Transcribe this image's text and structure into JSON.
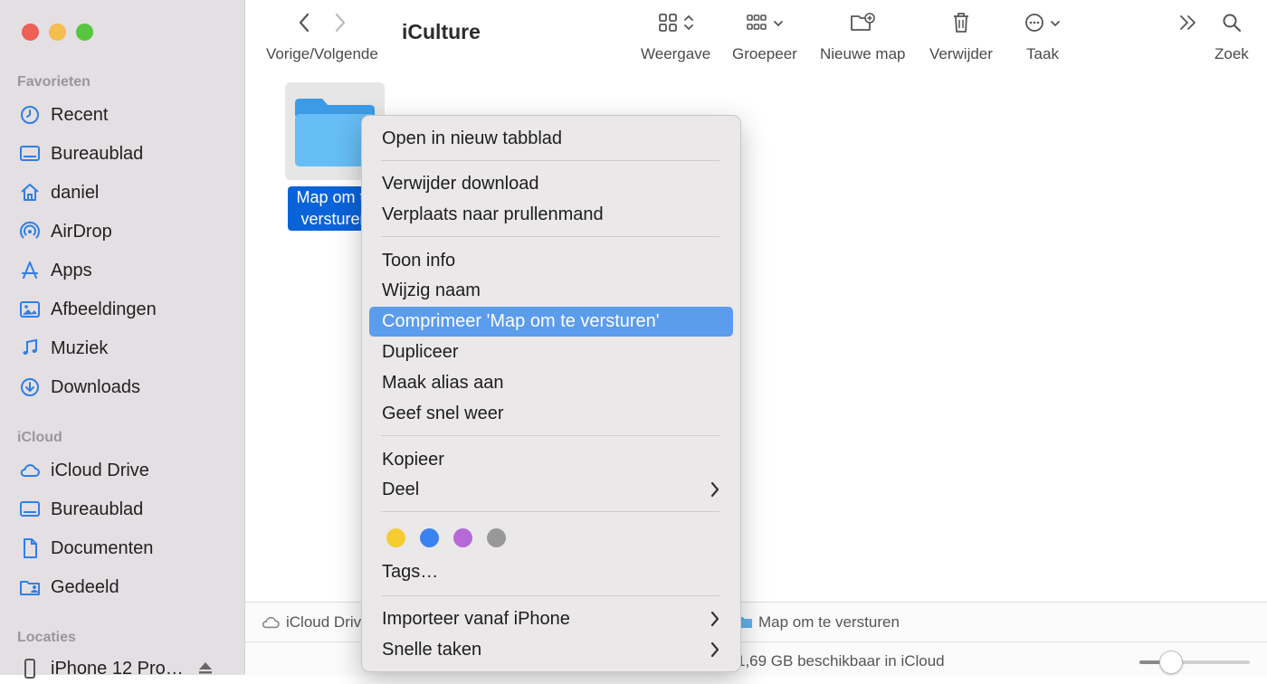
{
  "window": {
    "title": "iCulture"
  },
  "toolbar": {
    "nav_label": "Vorige/Volgende",
    "view_label": "Weergave",
    "group_label": "Groepeer",
    "new_folder_label": "Nieuwe map",
    "delete_label": "Verwijder",
    "action_label": "Taak",
    "search_label": "Zoek"
  },
  "sidebar": {
    "favorites_title": "Favorieten",
    "favorites": [
      {
        "label": "Recent",
        "icon": "clock-icon"
      },
      {
        "label": "Bureaublad",
        "icon": "desktop-icon"
      },
      {
        "label": "daniel",
        "icon": "home-icon"
      },
      {
        "label": "AirDrop",
        "icon": "airdrop-icon"
      },
      {
        "label": "Apps",
        "icon": "apps-icon"
      },
      {
        "label": "Afbeeldingen",
        "icon": "photos-icon"
      },
      {
        "label": "Muziek",
        "icon": "music-icon"
      },
      {
        "label": "Downloads",
        "icon": "downloads-icon"
      }
    ],
    "icloud_title": "iCloud",
    "icloud": [
      {
        "label": "iCloud Drive",
        "icon": "cloud-icon"
      },
      {
        "label": "Bureaublad",
        "icon": "desktop-icon"
      },
      {
        "label": "Documenten",
        "icon": "document-icon"
      },
      {
        "label": "Gedeeld",
        "icon": "shared-folder-icon"
      }
    ],
    "locations_title": "Locaties",
    "locations": [
      {
        "label": "iPhone 12 Pro…",
        "icon": "iphone-icon"
      }
    ]
  },
  "content": {
    "folder_name": "Map om te versturen"
  },
  "pathbar": {
    "root": "iCloud Drive",
    "current": "Map om te versturen"
  },
  "statusbar": {
    "text": "1,69 GB beschikbaar in iCloud"
  },
  "context_menu": {
    "items": [
      {
        "label": "Open in nieuw tabblad"
      },
      {
        "label": "Verwijder download"
      },
      {
        "label": "Verplaats naar prullenmand"
      },
      {
        "label": "Toon info"
      },
      {
        "label": "Wijzig naam"
      },
      {
        "label": "Comprimeer 'Map om te versturen'",
        "highlighted": true
      },
      {
        "label": "Dupliceer"
      },
      {
        "label": "Maak alias aan"
      },
      {
        "label": "Geef snel weer"
      },
      {
        "label": "Kopieer"
      },
      {
        "label": "Deel",
        "submenu": true
      },
      {
        "label": "Tags…"
      },
      {
        "label": "Importeer vanaf iPhone",
        "submenu": true
      },
      {
        "label": "Snelle taken",
        "submenu": true
      }
    ],
    "tag_colors": [
      "#f5cd30",
      "#3a82f0",
      "#b56ad8",
      "#98989a"
    ]
  },
  "colors": {
    "accent": "#0a63d8",
    "highlight": "#5b9ced",
    "folder": "#62b8f3"
  }
}
